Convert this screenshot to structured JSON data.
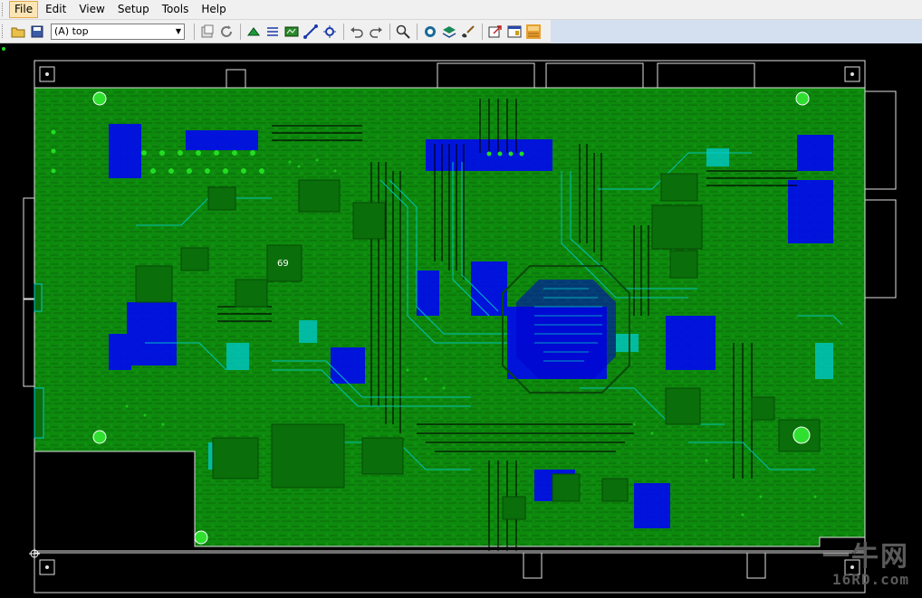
{
  "menubar": {
    "items": [
      {
        "label": "File",
        "key": "file"
      },
      {
        "label": "Edit",
        "key": "edit"
      },
      {
        "label": "View",
        "key": "view"
      },
      {
        "label": "Setup",
        "key": "setup"
      },
      {
        "label": "Tools",
        "key": "tools"
      },
      {
        "label": "Help",
        "key": "help"
      }
    ]
  },
  "toolbar": {
    "layer_select": {
      "value": "(A) top"
    },
    "icons": [
      "open-folder-icon",
      "save-icon",
      "properties-icon",
      "refresh-icon",
      "add-component-icon",
      "route-icon",
      "sketch-icon",
      "line-icon",
      "via-icon",
      "undo-icon",
      "redo-icon",
      "zoom-icon",
      "board-view-icon",
      "layers-icon",
      "brush-icon",
      "export-icon",
      "window-icon",
      "pads-logo-icon"
    ]
  },
  "board": {
    "component_label": "69",
    "colors": {
      "background": "#000000",
      "copper_top": "#0d8a0d",
      "copper_inner": "#0000ff",
      "trace_cyan": "#00c8c8",
      "outline": "#ffffff",
      "via": "#22dd22"
    }
  },
  "watermark": {
    "line1": "一牛网",
    "line2": "16RD.com"
  }
}
